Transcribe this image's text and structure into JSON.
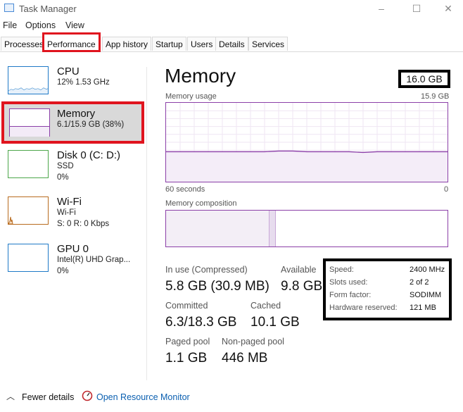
{
  "window": {
    "title": "Task Manager",
    "controls": {
      "minimize": "–",
      "maximize": "☐",
      "close": "✕"
    }
  },
  "menu": [
    "File",
    "Options",
    "View"
  ],
  "tabs": [
    {
      "label": "Processes",
      "active": false
    },
    {
      "label": "Performance",
      "active": true
    },
    {
      "label": "App history",
      "active": false
    },
    {
      "label": "Startup",
      "active": false
    },
    {
      "label": "Users",
      "active": false
    },
    {
      "label": "Details",
      "active": false
    },
    {
      "label": "Services",
      "active": false
    }
  ],
  "sidebar": {
    "items": [
      {
        "title": "CPU",
        "sub1": "12%  1.53 GHz",
        "sub2": "",
        "color": "#1f7ac7"
      },
      {
        "title": "Memory",
        "sub1": "6.1/15.9 GB (38%)",
        "sub2": "",
        "color": "#8b3fa8"
      },
      {
        "title": "Disk 0 (C: D:)",
        "sub1": "SSD",
        "sub2": "0%",
        "color": "#4ca64a"
      },
      {
        "title": "Wi-Fi",
        "sub1": "Wi-Fi",
        "sub2": "S: 0  R: 0 Kbps",
        "color": "#b86b1e"
      },
      {
        "title": "GPU 0",
        "sub1": "Intel(R) UHD Grap...",
        "sub2": "0%",
        "color": "#1f7ac7"
      }
    ]
  },
  "main": {
    "title": "Memory",
    "capacity": "16.0 GB",
    "usage_label": "Memory usage",
    "usage_max": "15.9 GB",
    "time_left": "60 seconds",
    "time_right": "0",
    "usage_fraction": 0.38,
    "composition_label": "Memory composition",
    "stats": {
      "in_use_label": "In use (Compressed)",
      "in_use_value": "5.8 GB (30.9 MB)",
      "available_label": "Available",
      "available_value": "9.8 GB",
      "committed_label": "Committed",
      "committed_value": "6.3/18.3 GB",
      "cached_label": "Cached",
      "cached_value": "10.1 GB",
      "paged_label": "Paged pool",
      "paged_value": "1.1 GB",
      "nonpaged_label": "Non-paged pool",
      "nonpaged_value": "446 MB"
    },
    "specs": [
      {
        "label": "Speed:",
        "value": "2400 MHz"
      },
      {
        "label": "Slots used:",
        "value": "2 of 2"
      },
      {
        "label": "Form factor:",
        "value": "SODIMM"
      },
      {
        "label": "Hardware reserved:",
        "value": "121 MB"
      }
    ]
  },
  "footer": {
    "fewer_details": "Fewer details",
    "open_monitor": "Open Resource Monitor"
  },
  "colors": {
    "memory": "#8b3fa8",
    "highlight": "#e0141e"
  }
}
